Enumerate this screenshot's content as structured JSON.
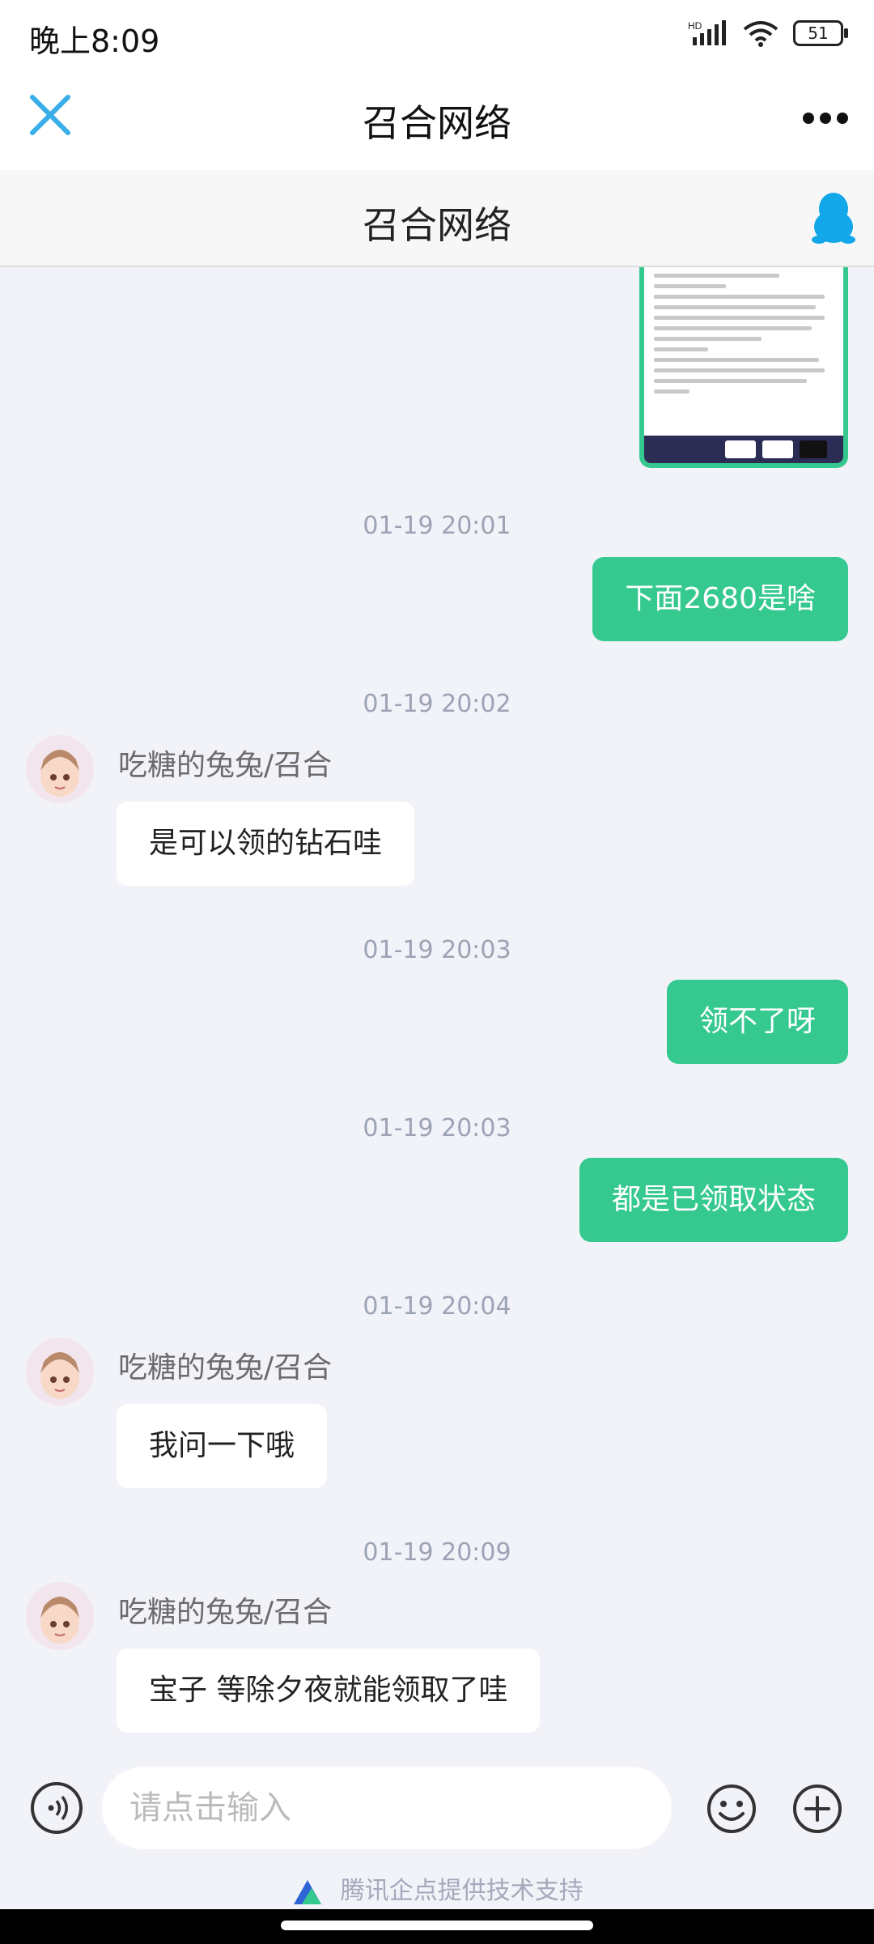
{
  "status_bar": {
    "time": "晚上8:09",
    "battery": "51",
    "network": "HD"
  },
  "nav": {
    "title": "召合网络"
  },
  "sub_header": {
    "title": "召合网络"
  },
  "messages": [
    {
      "timestamp": "01-19 20:01",
      "direction": "out",
      "text": "下面2680是啥"
    },
    {
      "timestamp": "01-19 20:02",
      "direction": "in",
      "sender": "吃糖的兔兔/召合",
      "text": "是可以领的钻石哇"
    },
    {
      "timestamp": "01-19 20:03",
      "direction": "out",
      "text": "领不了呀"
    },
    {
      "timestamp": "01-19 20:03",
      "direction": "out",
      "text": "都是已领取状态"
    },
    {
      "timestamp": "01-19 20:04",
      "direction": "in",
      "sender": "吃糖的兔兔/召合",
      "text": "我问一下哦"
    },
    {
      "timestamp": "01-19 20:09",
      "direction": "in",
      "sender": "吃糖的兔兔/召合",
      "text": "宝子 等除夕夜就能领取了哇"
    }
  ],
  "input": {
    "placeholder": "请点击输入"
  },
  "footer": {
    "powered_by": "腾讯企点提供技术支持"
  },
  "colors": {
    "accent": "#35c98f",
    "close_icon": "#3aaee8",
    "qq_icon": "#12a7e8"
  }
}
